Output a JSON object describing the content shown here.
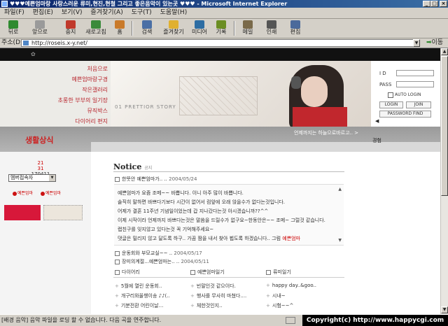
{
  "window": {
    "title": "♥♥♥예쁜엄마랑 사랑스러운 류미,현진,현철 그리고 좋은음악이 있는곳 ♥♥♥ - Microsoft Internet Explorer",
    "minimize": "_",
    "maximize": "□",
    "close": "×"
  },
  "menu": [
    "파일(F)",
    "편집(E)",
    "보기(V)",
    "즐겨찾기(A)",
    "도구(T)",
    "도움말(H)"
  ],
  "toolbar": [
    {
      "label": "뒤로",
      "icon": "back-arrow-icon",
      "color": "#2f8a2f"
    },
    {
      "label": "앞으로",
      "icon": "forward-arrow-icon",
      "color": "#9a9a9a"
    },
    {
      "label": "중지",
      "icon": "stop-icon",
      "color": "#c0392b"
    },
    {
      "label": "새로고침",
      "icon": "refresh-icon",
      "color": "#3a8a3a"
    },
    {
      "label": "홈",
      "icon": "home-icon",
      "color": "#c97a2a"
    },
    {
      "label": "검색",
      "icon": "search-icon",
      "color": "#4a6fa5"
    },
    {
      "label": "즐겨찾기",
      "icon": "favorites-icon",
      "color": "#e0b030"
    },
    {
      "label": "미디어",
      "icon": "media-icon",
      "color": "#2d6da3"
    },
    {
      "label": "기록",
      "icon": "history-icon",
      "color": "#6b8e23"
    },
    {
      "label": "메일",
      "icon": "mail-icon",
      "color": "#7a6a4a"
    },
    {
      "label": "인쇄",
      "icon": "print-icon",
      "color": "#555555"
    },
    {
      "label": "편집",
      "icon": "edit-icon",
      "color": "#4b6a9b"
    }
  ],
  "address": {
    "label": "주소(D)",
    "url": "http://roseis.x-y.net/",
    "go": "이동"
  },
  "site": {
    "nav": [
      "처음으로",
      "예쁜엄마랑구경",
      "작은갤러리",
      "초롱한 부부의 일기장",
      "뮤직박스",
      "다이어리 편지"
    ],
    "hero_caption": "01  PRETTIOR STORY",
    "login": {
      "id_label": "I D",
      "pass_label": "PASS",
      "auto_login": "AUTO LOGIN",
      "login_button": "LOGIN",
      "join_button": "JOIN",
      "find_button": "PASSWORD FIND"
    },
    "band_tag": "생활상식",
    "band_right": "언제까지는 하늘으로바르고.. >",
    "side_label": "경험",
    "counter_today": "21",
    "counter_yesterday": "31",
    "counter_total": "170411",
    "select_value": "멤버접속자",
    "badge_left": "예쁜엄마",
    "badge_right": "예쁜엄마"
  },
  "notice": {
    "title": "Notice",
    "subtitle": "공지",
    "posts": [
      {
        "title": "한뜻안 예쁜엄마가..",
        "date": "2004/05/24"
      },
      {
        "title": "운동회와 부모교실~~",
        "date": "2004/05/17"
      },
      {
        "title": "장미의계절...예쁜엄마는..",
        "date": "2004/05/11"
      }
    ],
    "body_lines": [
      "예쁜엄마가 요즘 조메~~ 바쁩니다. 이니 아주 많이 바쁩니다.",
      "솔직히 말하면 바쁘다기보다 시간이 없어서 컴앞에 오래 앉을수가 없다는것입니다.",
      "어제가 결혼 11주년 기념일이었는데 갑 지나갔다는것 아시겠습니까??^^",
      "이제 시작이라 언제까지 바쁘다는것은 말씀을 드릴수가 없구요~한동안은~~ 조메~ 그럴것 같습니다.",
      "랩친구를 잊지않고 있다는것 꼭 기억해주세요~",
      "댓글은 밀리지 않고 달도록 하구.. 가끔 짬을 내서 찾아 뵙도록 하겠습니다.. 그럼"
    ],
    "body_sign": "예쁜엄마"
  },
  "boards": [
    {
      "title": "다이어리",
      "items": [
        "5월에 열린 운동회..",
        "개구리와올챙이송 ♪♪(..",
        "기분전환 어린이날..."
      ]
    },
    {
      "title": "예쁜엄마일기",
      "items": [
        "빈말인것 같으이다.",
        "행사를 무사히 마쳤다....",
        "체한것인지.."
      ]
    },
    {
      "title": "류미일기",
      "items": [
        "happy day..&goo..",
        "시내~",
        "시험~~^"
      ]
    }
  ],
  "status": {
    "text": "[배경 음악] 음악 파일을 로딩 할 수 없습니다. 다음 곡을 연주합니다.",
    "copyright": "Copyright(c) http://www.happycgi.com"
  }
}
